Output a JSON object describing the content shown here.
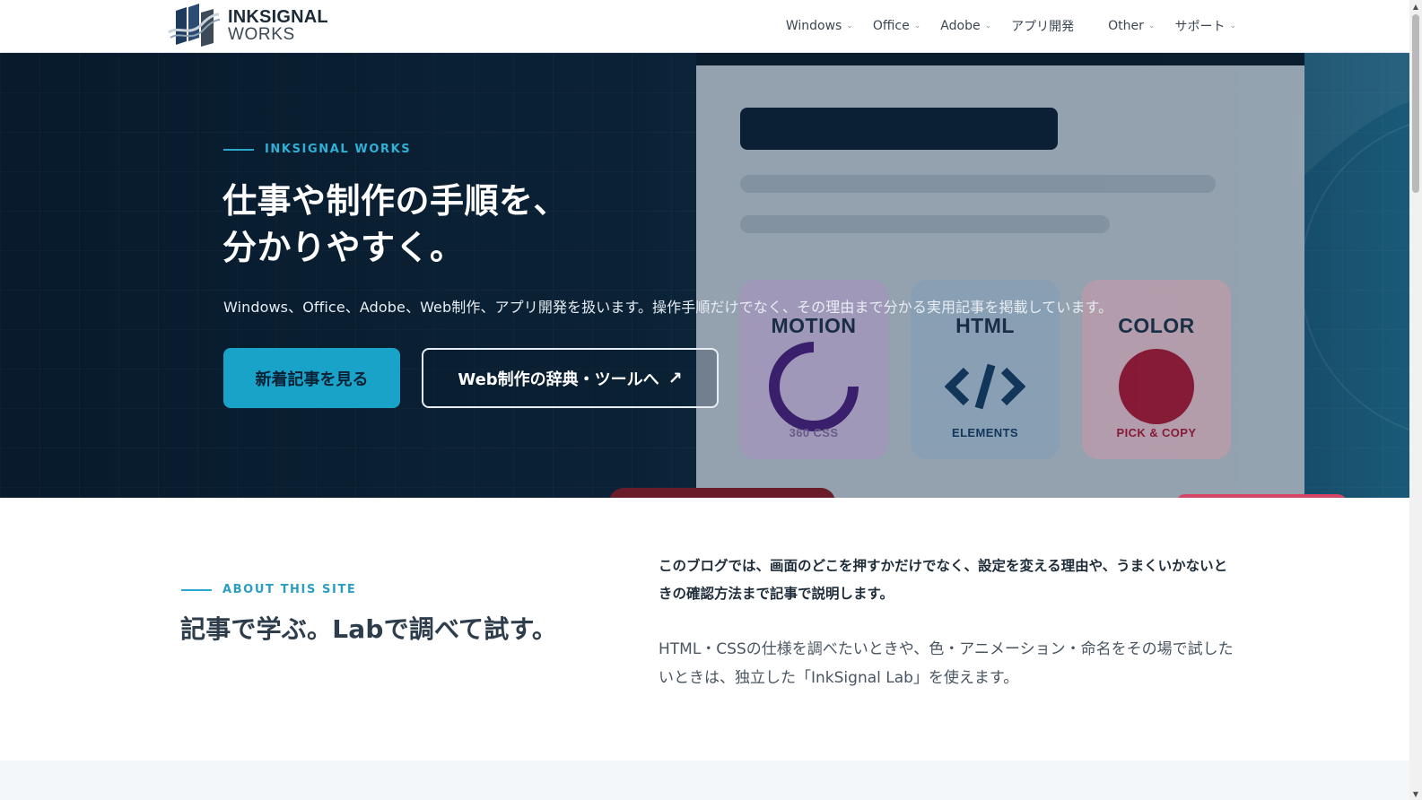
{
  "header": {
    "logo_line1": "INKSIGNAL",
    "logo_line2": "WORKS",
    "nav": [
      {
        "label": "Windows",
        "dropdown": true
      },
      {
        "label": "Office",
        "dropdown": true
      },
      {
        "label": "Adobe",
        "dropdown": true
      },
      {
        "label": "アプリ開発",
        "dropdown": false
      },
      {
        "label": "Other",
        "dropdown": true
      },
      {
        "label": "サポート",
        "dropdown": true
      }
    ]
  },
  "hero": {
    "eyebrow": "INKSIGNAL WORKS",
    "title_line1": "仕事や制作の手順を、",
    "title_line2": "分かりやすく。",
    "description": "Windows、Office、Adobe、Web制作、アプリ開発を扱います。操作手順だけでなく、その理由まで分かる実用記事を掲載しています。",
    "primary_button": "新着記事を見る",
    "secondary_button": "Web制作の辞典・ツールへ",
    "secondary_icon": "external-link-icon",
    "cards": [
      {
        "title": "MOTION",
        "subtitle": "360 CSS",
        "icon": "spinner-icon",
        "accent": "#3b1f6e"
      },
      {
        "title": "HTML",
        "subtitle": "ELEMENTS",
        "icon": "code-icon",
        "accent": "#13375a"
      },
      {
        "title": "COLOR",
        "subtitle": "PICK & COPY",
        "icon": "color-dot-icon",
        "accent": "#8a1a36"
      }
    ]
  },
  "about": {
    "eyebrow": "ABOUT THIS SITE",
    "title": "記事で学ぶ。Labで調べて試す。",
    "lead": "このブログでは、画面のどこを押すかだけでなく、設定を変える理由や、うまくいかないときの確認方法まで記事で説明します。",
    "body": "HTML・CSSの仕様を調べたいときや、色・アニメーション・命名をその場で試したいときは、独立した「InkSignal Lab」を使えます。"
  },
  "colors": {
    "accent": "#1aa3c9",
    "hero_dark": "#081a2c",
    "text_dark": "#1f2d3a"
  }
}
